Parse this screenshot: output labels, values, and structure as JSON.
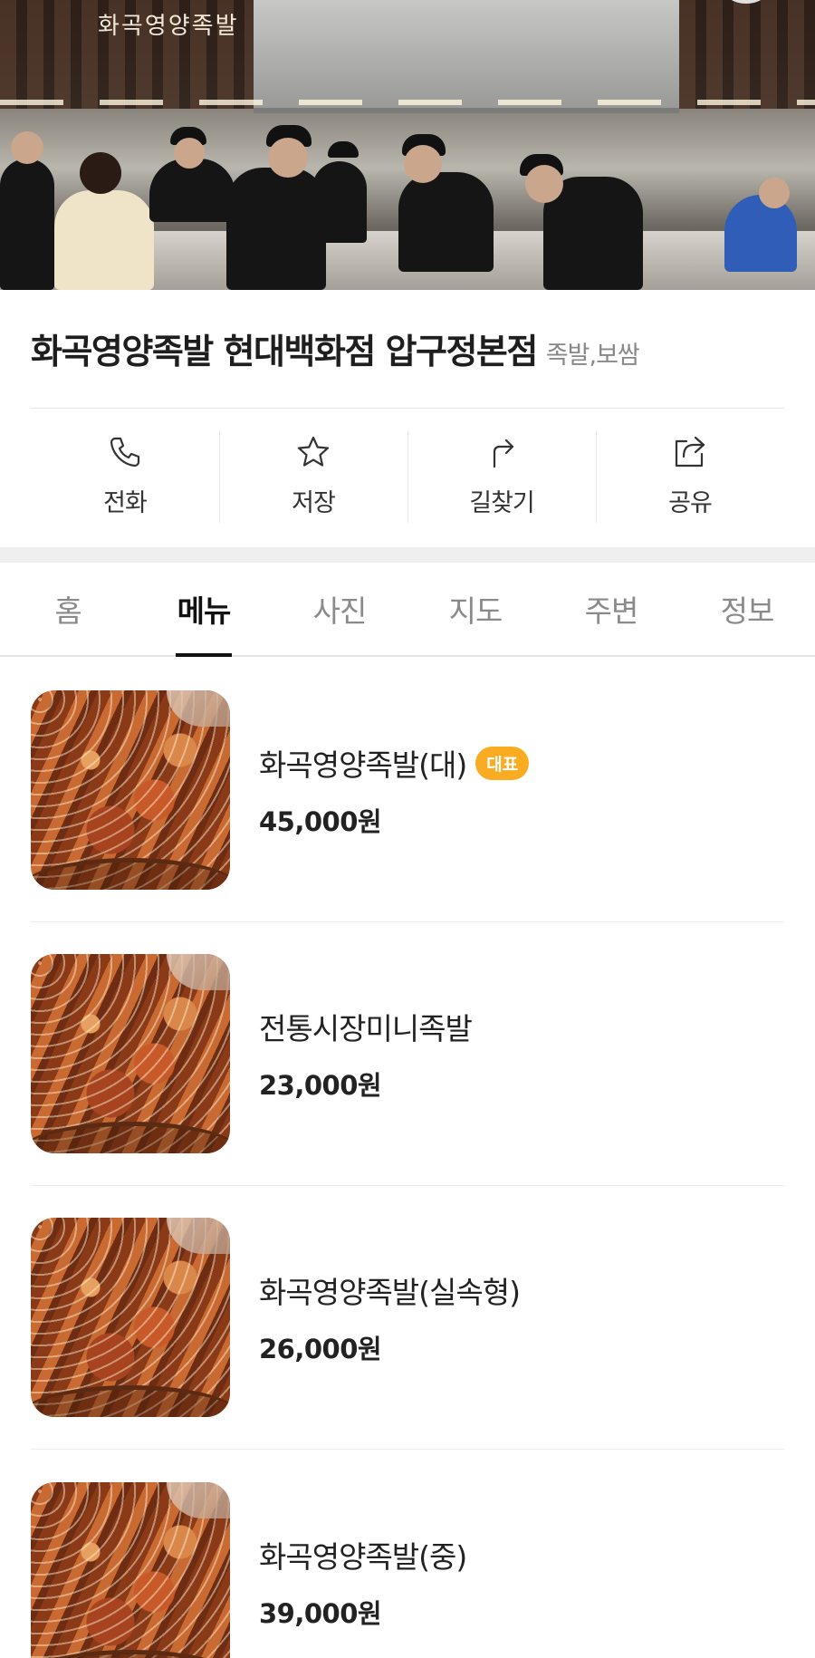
{
  "hero": {
    "sign_text": "화곡영양족발"
  },
  "store": {
    "name": "화곡영양족발 현대백화점 압구정본점",
    "category": "족발,보쌈"
  },
  "actions": [
    {
      "label": "전화",
      "icon": "phone-icon"
    },
    {
      "label": "저장",
      "icon": "star-icon"
    },
    {
      "label": "길찾기",
      "icon": "directions-icon"
    },
    {
      "label": "공유",
      "icon": "share-icon"
    }
  ],
  "tabs": [
    {
      "label": "홈",
      "active": false
    },
    {
      "label": "메뉴",
      "active": true
    },
    {
      "label": "사진",
      "active": false
    },
    {
      "label": "지도",
      "active": false
    },
    {
      "label": "주변",
      "active": false
    },
    {
      "label": "정보",
      "active": false
    }
  ],
  "menu_items": [
    {
      "name": "화곡영양족발(대)",
      "badge": "대표",
      "price": "45,000원"
    },
    {
      "name": "전통시장미니족발",
      "price": "23,000원"
    },
    {
      "name": "화곡영양족발(실속형)",
      "price": "26,000원"
    },
    {
      "name": "화곡영양족발(중)",
      "price": "39,000원"
    }
  ],
  "colors": {
    "badge": "#f9ab22",
    "active_tab": "#111111",
    "inactive_tab": "#8a8a8a"
  }
}
